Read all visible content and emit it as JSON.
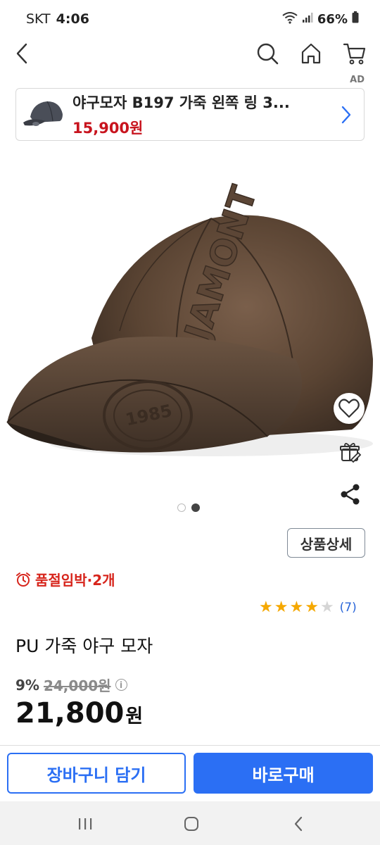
{
  "status": {
    "carrier": "SKT",
    "time": "4:06",
    "battery": "66%"
  },
  "ad": {
    "label": "AD",
    "title": "야구모자 B197 가죽 왼쪽 링 3...",
    "price": "15,900원"
  },
  "product": {
    "detail_button": "상품상세",
    "stock_notice": "품절임박·2개",
    "rating": 4,
    "review_count": "(7)",
    "name": "PU 가죽 야구 모자",
    "discount_rate": "9%",
    "original_price": "24,000원",
    "sale_price": "21,800",
    "sale_unit": "원",
    "image_index": 2,
    "image_total": 2
  },
  "actions": {
    "cart_label": "장바구니 담기",
    "buy_label": "바로구매"
  },
  "colors": {
    "accent": "#2b6ff4",
    "price_red": "#c8141e",
    "stock_red": "#d7251c",
    "star": "#f5a800"
  },
  "icons": [
    "back-icon",
    "search-icon",
    "home-icon",
    "cart-icon",
    "heart-icon",
    "gift-icon",
    "share-icon",
    "alarm-clock-icon",
    "info-icon"
  ]
}
